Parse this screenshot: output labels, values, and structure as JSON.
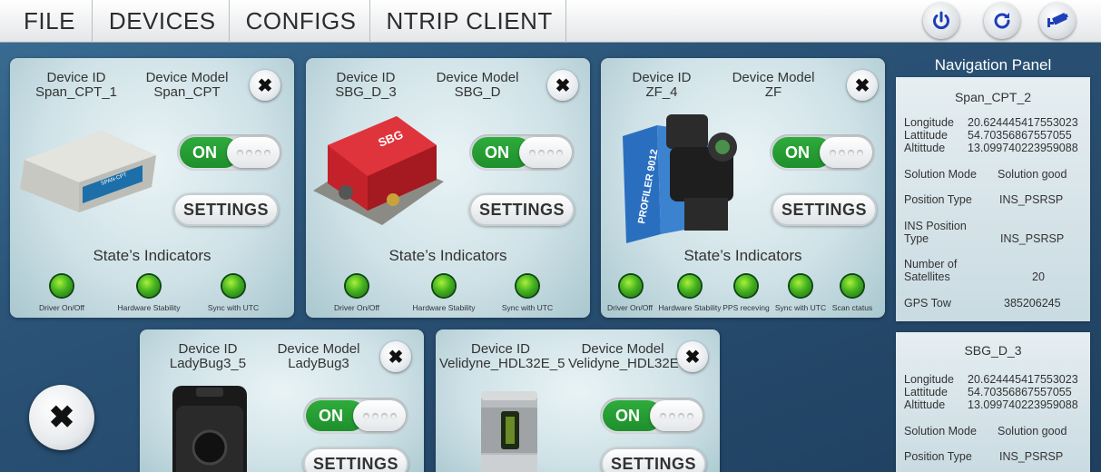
{
  "menu": [
    "FILE",
    "DEVICES",
    "CONFIGS",
    "NTRIP CLIENT"
  ],
  "toolbar_icons": [
    "power-icon",
    "refresh-icon",
    "camera-icon"
  ],
  "colors": {
    "accent_green": "#2eab3c",
    "led_green": "#45b320",
    "background": "#2b5478"
  },
  "common": {
    "id_label": "Device ID",
    "model_label": "Device Model",
    "on_label": "ON",
    "settings_label": "SETTINGS",
    "close_glyph": "✖",
    "indicators_title": "State’s Indicators"
  },
  "devices": [
    {
      "id": "Span_CPT_1",
      "model": "Span_CPT",
      "indicators": [
        "Driver On/Off",
        "Hardware Stability",
        "Sync with UTC"
      ]
    },
    {
      "id": "SBG_D_3",
      "model": "SBG_D",
      "indicators": [
        "Driver On/Off",
        "Hardware Stability",
        "Sync with UTC"
      ]
    },
    {
      "id": "ZF_4",
      "model": "ZF",
      "indicators": [
        "Driver On/Off",
        "Hardware Stability",
        "PPS receving",
        "Sync with UTC",
        "Scan ctatus"
      ]
    },
    {
      "id": "LadyBug3_5",
      "model": "LadyBug3"
    },
    {
      "id": "Velidyne_HDL32E_5",
      "model": "Velidyne_HDL32E"
    }
  ],
  "nav": {
    "title": "Navigation Panel",
    "labels": {
      "longitude": "Longitude",
      "lattitude": "Lattitude",
      "altitude": "Altittude",
      "solution_mode": "Solution Mode",
      "position_type": "Position Type",
      "ins_position_type": "INS Position Type",
      "num_satellites": "Number of Satellites",
      "gps_tow": "GPS Tow"
    },
    "panels": [
      {
        "name": "Span_CPT_2",
        "longitude": "20.624445417553023",
        "lattitude": "54.70356867557055",
        "altitude": "13.099740223959088",
        "solution_mode": "Solution good",
        "position_type": "INS_PSRSP",
        "ins_position_type": "INS_PSRSP",
        "num_satellites": "20",
        "gps_tow": "385206245"
      },
      {
        "name": "SBG_D_3",
        "longitude": "20.624445417553023",
        "lattitude": "54.70356867557055",
        "altitude": "13.099740223959088",
        "solution_mode": "Solution good",
        "position_type": "INS_PSRSP"
      }
    ]
  },
  "device_images": {
    "span_cpt_label": "SPAN-CPT",
    "sbg_logo": "SBG",
    "zf_label": "PROFILER 9012"
  }
}
